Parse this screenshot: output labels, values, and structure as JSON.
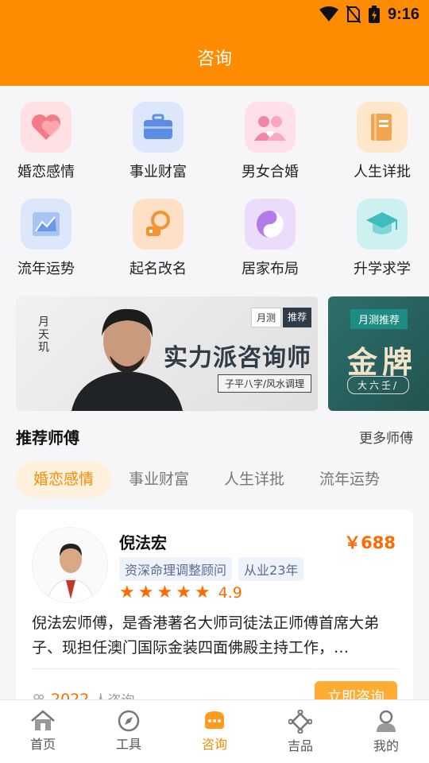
{
  "status": {
    "time": "9:16"
  },
  "header": {
    "title": "咨询"
  },
  "categories": [
    {
      "label": "婚恋感情",
      "icon": "heart-icon",
      "bg": "#ffe0e3",
      "color": "#f27b87"
    },
    {
      "label": "事业财富",
      "icon": "briefcase-icon",
      "bg": "#dce7fb",
      "color": "#5b8de3"
    },
    {
      "label": "男女合婚",
      "icon": "couple-icon",
      "bg": "#ffdfe9",
      "color": "#f284a9"
    },
    {
      "label": "人生详批",
      "icon": "book-icon",
      "bg": "#ffe7cc",
      "color": "#f2a54d"
    },
    {
      "label": "流年运势",
      "icon": "chart-icon",
      "bg": "#dce7fb",
      "color": "#6a98e8"
    },
    {
      "label": "起名改名",
      "icon": "name-icon",
      "bg": "#ffe0c6",
      "color": "#f49331"
    },
    {
      "label": "居家布局",
      "icon": "yinyang-icon",
      "bg": "#ecdcfb",
      "color": "#b37be8"
    },
    {
      "label": "升学求学",
      "icon": "graduation-cap-icon",
      "bg": "#cdf1f1",
      "color": "#3fbcbc"
    }
  ],
  "banners": [
    {
      "tag1": "月测",
      "tag2": "推荐",
      "title": "实力派咨询师",
      "subtitle": "子平八字/风水调理",
      "seal": "月天玑"
    },
    {
      "tag": "月测推荐",
      "title": "金牌",
      "subtitle": "大六壬/"
    }
  ],
  "section": {
    "title": "推荐师傅",
    "more": "更多师傅"
  },
  "tabs": [
    "婚恋感情",
    "事业财富",
    "人生详批",
    "流年运势"
  ],
  "master": {
    "name": "倪法宏",
    "price": "￥688",
    "tags": [
      "资深命理调整顾问",
      "从业23年"
    ],
    "rating": "4.9",
    "stars": 5,
    "description": "倪法宏师傅，是香港著名大师司徒法正师傅首席大弟子、现担任澳门国际金装四面佛殿主持工作，…",
    "consult_count": "2022",
    "consult_suffix": "人咨询",
    "consult_button": "立即咨询"
  },
  "bottom_nav": [
    {
      "label": "首页",
      "icon": "home-icon",
      "active": false
    },
    {
      "label": "工具",
      "icon": "compass-icon",
      "active": false
    },
    {
      "label": "咨询",
      "icon": "chat-icon",
      "active": true
    },
    {
      "label": "吉品",
      "icon": "knot-icon",
      "active": false
    },
    {
      "label": "我的",
      "icon": "user-icon",
      "active": false
    }
  ],
  "colors": {
    "brand": "#ff8c00",
    "accent": "#ff6a00"
  }
}
